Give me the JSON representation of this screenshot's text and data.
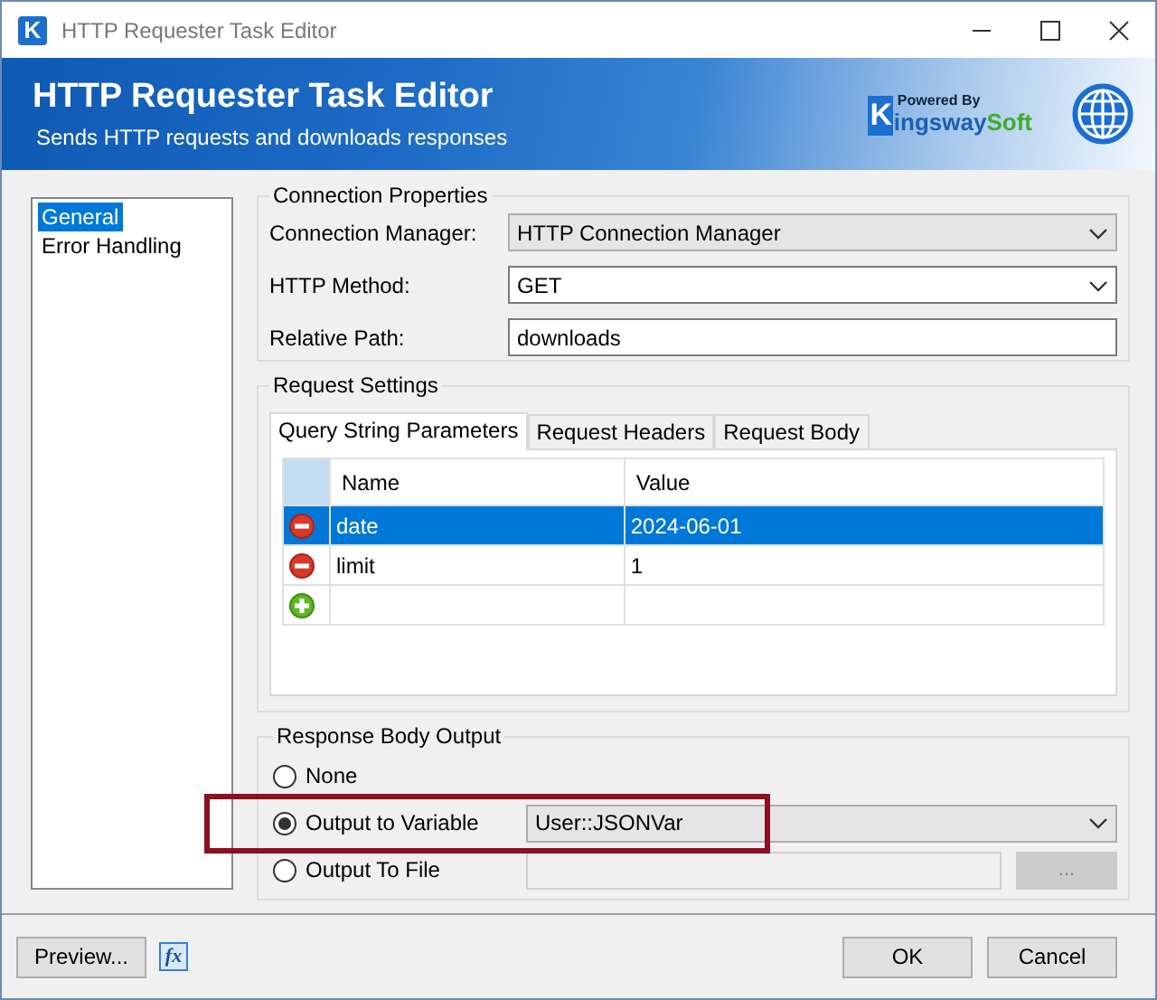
{
  "window": {
    "title": "HTTP Requester Task Editor",
    "icon_letter": "K"
  },
  "banner": {
    "title": "HTTP Requester Task Editor",
    "subtitle": "Sends HTTP requests and downloads responses",
    "logo": {
      "tagline": "Powered By",
      "initial": "K",
      "name": "ingsway",
      "accent": "Soft"
    }
  },
  "nav": {
    "items": [
      {
        "label": "General",
        "selected": true
      },
      {
        "label": "Error Handling",
        "selected": false
      }
    ]
  },
  "connection_properties": {
    "title": "Connection Properties",
    "fields": [
      {
        "kind": "select",
        "label": "Connection Manager:",
        "value": "HTTP Connection Manager"
      },
      {
        "kind": "combo",
        "label": "HTTP Method:",
        "value": "GET"
      },
      {
        "kind": "text",
        "label": "Relative Path:",
        "value": "downloads"
      }
    ]
  },
  "request_settings": {
    "title": "Request Settings",
    "tabs": [
      {
        "label": "Query String Parameters",
        "selected": true
      },
      {
        "label": "Request Headers",
        "selected": false
      },
      {
        "label": "Request Body",
        "selected": false
      }
    ],
    "grid": {
      "columns": [
        "Name",
        "Value"
      ],
      "rows": [
        {
          "kind": "remove",
          "name": "date",
          "value": "2024-06-01",
          "selected": true
        },
        {
          "kind": "remove",
          "name": "limit",
          "value": "1",
          "selected": false
        },
        {
          "kind": "add",
          "selected": false
        }
      ]
    }
  },
  "response_body_output": {
    "title": "Response Body Output",
    "options": [
      {
        "label": "None",
        "selected": false,
        "highlighted": false
      },
      {
        "label": "Output to Variable",
        "selected": true,
        "highlighted": true,
        "field": {
          "kind": "select",
          "value": "User::JSONVar"
        }
      },
      {
        "label": "Output To File",
        "selected": false,
        "highlighted": false,
        "field": {
          "kind": "text",
          "disabled": true
        },
        "browse_button": {
          "label": "...",
          "disabled": true
        }
      }
    ]
  },
  "footer": {
    "preview_button": "Preview...",
    "expression_button": "fx",
    "buttons": [
      "OK",
      "Cancel"
    ]
  }
}
